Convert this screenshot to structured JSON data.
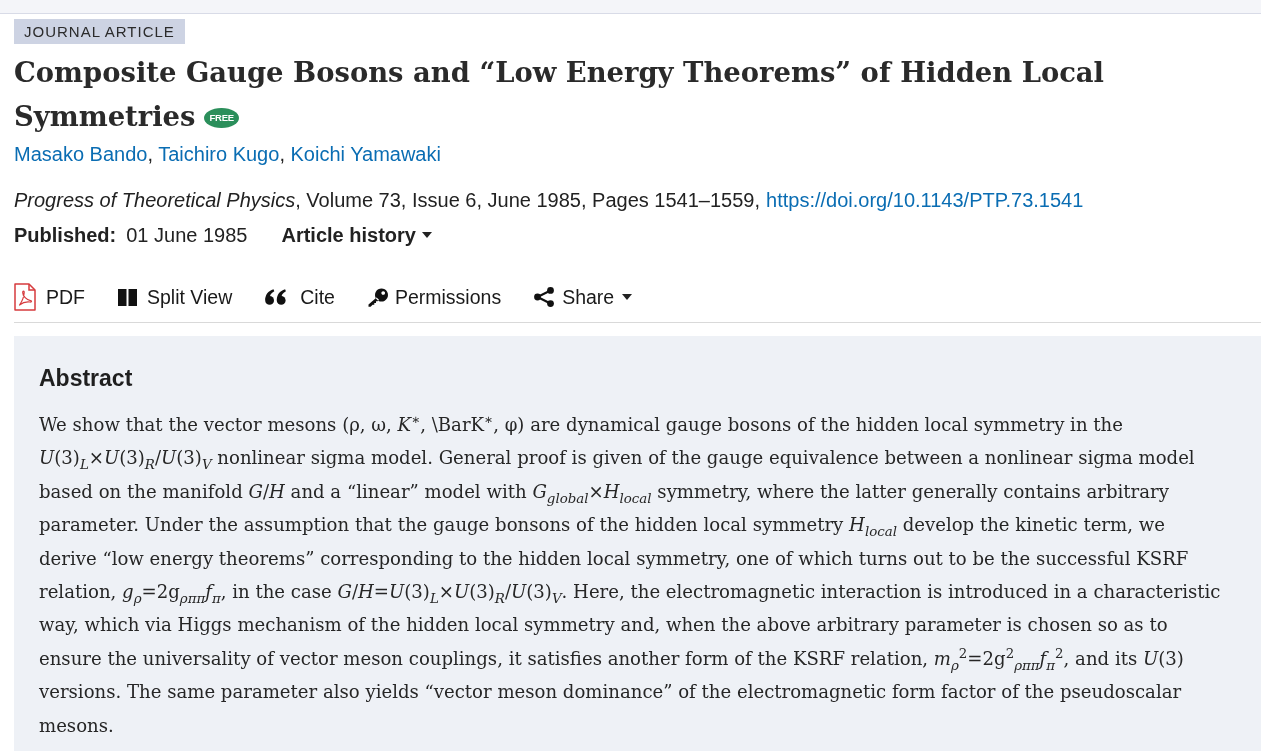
{
  "article": {
    "type_label": "JOURNAL ARTICLE",
    "title": "Composite Gauge Bosons and “Low Energy Theorems” of Hidden Local Symmetries",
    "access_badge": "FREE",
    "authors": [
      "Masako Bando",
      "Taichiro Kugo",
      "Koichi Yamawaki"
    ],
    "author_separator": ",",
    "citation": {
      "text": "*Progress of Theoretical Physics*, Volume 73, Issue 6, June 1985, Pages 1541–1559,",
      "doi": "https://doi.org/10.1143/PTP.73.1541"
    },
    "published": {
      "label": "Published:",
      "date": "01 June 1985"
    },
    "history": {
      "label": "Article history",
      "has_menu": true
    }
  },
  "toolbar": [
    {
      "kind": "pdf",
      "label": "PDF",
      "has_menu": false
    },
    {
      "kind": "split",
      "label": "Split View",
      "has_menu": false
    },
    {
      "kind": "cite",
      "label": "Cite",
      "has_menu": false
    },
    {
      "kind": "permissions",
      "label": "Permissions",
      "has_menu": false
    },
    {
      "kind": "share",
      "label": "Share",
      "has_menu": true
    }
  ],
  "abstract": {
    "heading": "Abstract",
    "text": "We show that the vector mesons (ρ, ω, *K*$^{∗}$, \\BarK$^{∗}$, φ) are dynamical gauge bosons of the hidden local symmetry in the *U*(3)$_{L}$×*U*(3)$_{R}$/*U*(3)$_{V}$ nonlinear sigma model. General proof is given of the gauge equivalence between a nonlinear sigma model based on the manifold *G*/*H* and a “linear” model with *G*$_{global}$×*H*$_{local}$ symmetry, where the latter generally contains arbitrary parameter. Under the assumption that the gauge bonsons of the hidden local symmetry *H*$_{local}$ develop the kinetic term, we derive “low energy theorems” corresponding to the hidden local symmetry, one of which turns out to be the successful KSRF relation, *g*$_{ρ}$=2g$_{ρππ}$*f*$_{π}$, in the case *G*/*H*=*U*(3)$_{L}$×*U*(3)$_{R}$/*U*(3)$_{V}$. Here, the electromagnetic interaction is introduced in a characteristic way, which via Higgs mechanism of the hidden local symmetry and, when the above arbitrary parameter is chosen so as to ensure the universality of vector meson couplings, it satisfies another form of the KSRF relation, *m*$_{ρ}$$^{2}$=2g$^{2}$$_{ρππ}$*f*$_{π}$$^{2}$, and its *U*(3) versions. The same parameter also yields “vector meson dominance” of the electromagnetic form factor of the pseudoscalar mesons."
  }
}
